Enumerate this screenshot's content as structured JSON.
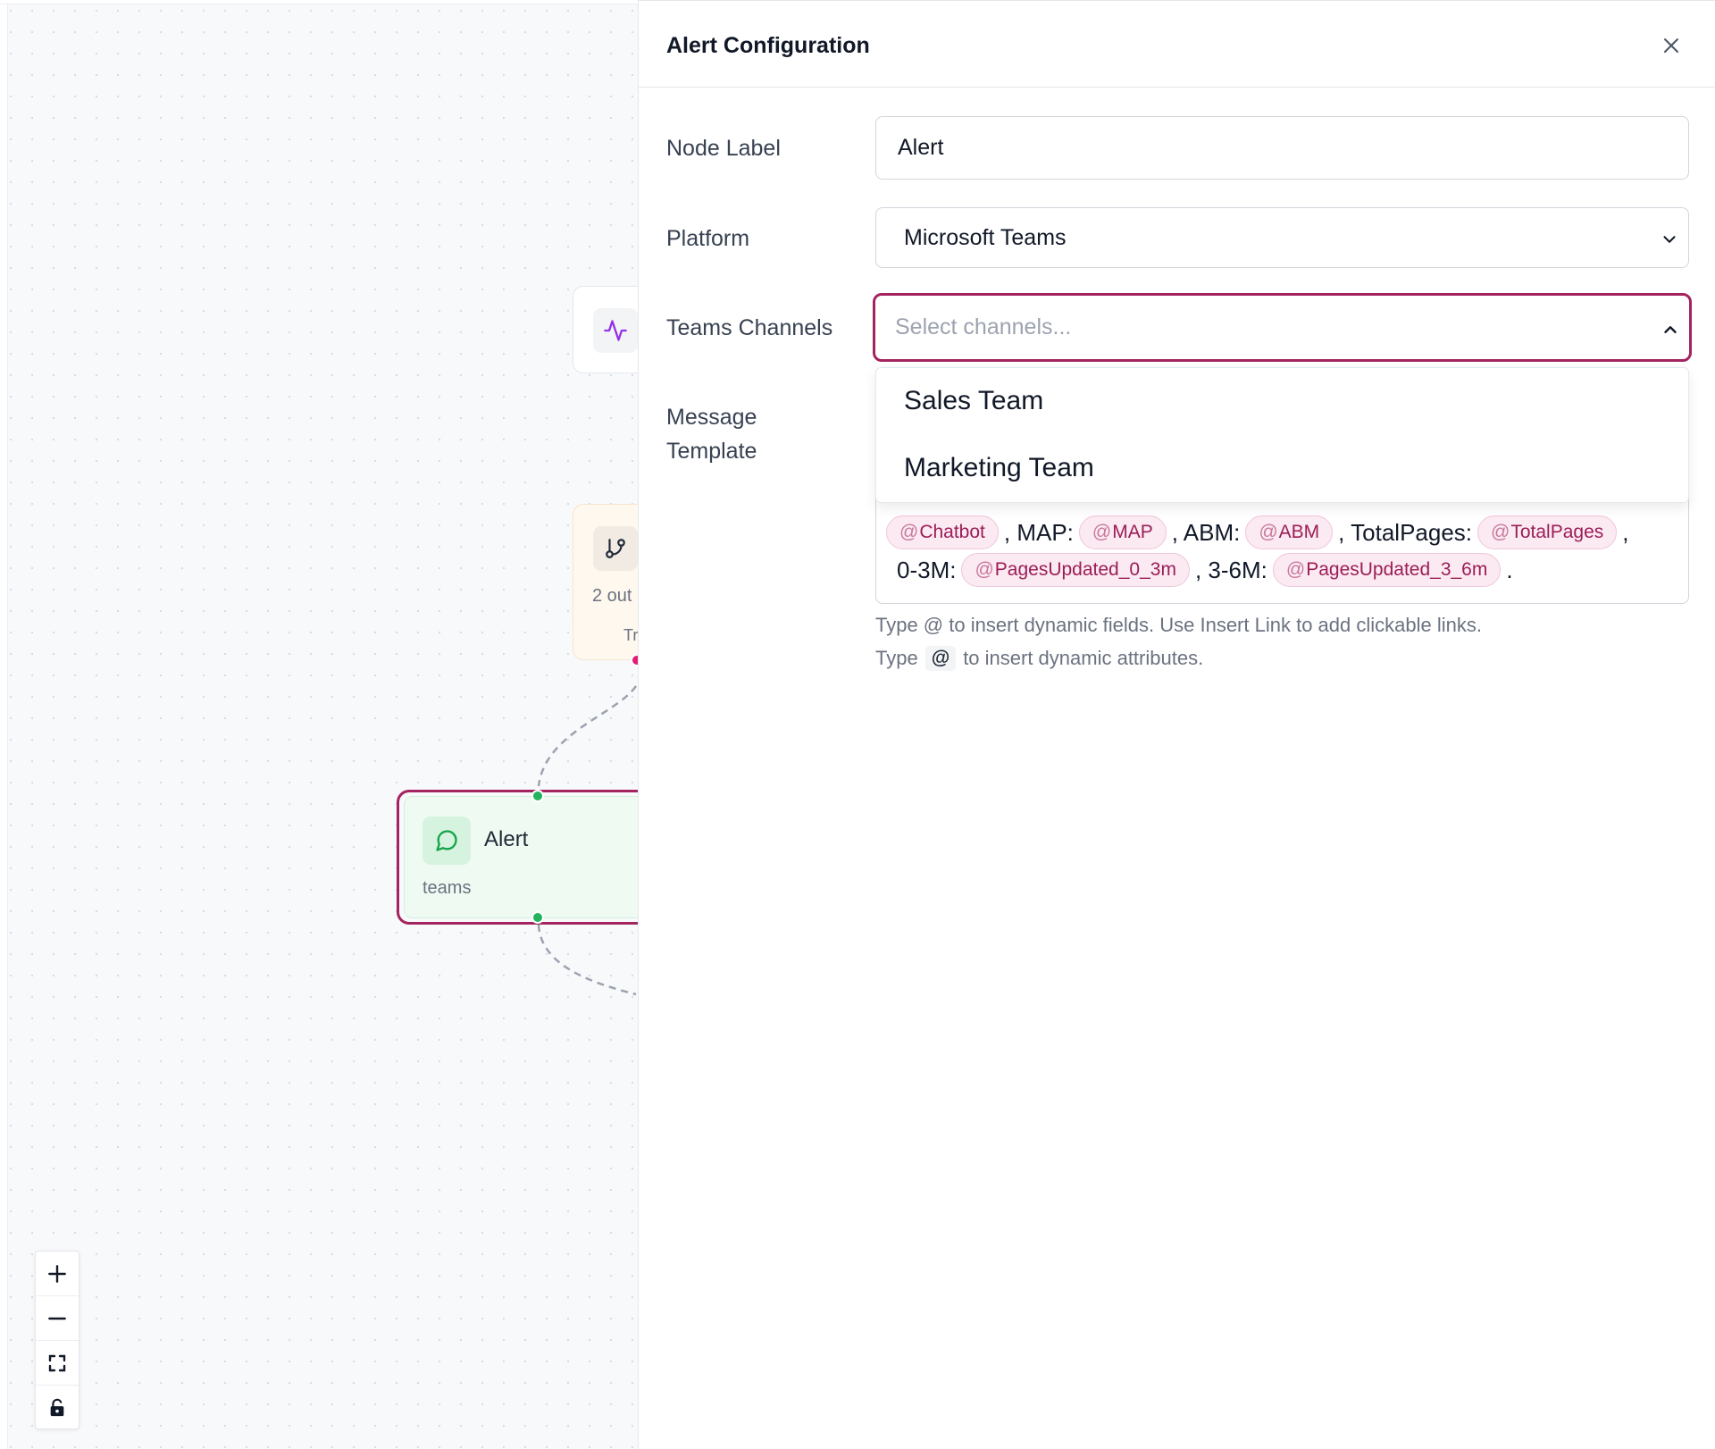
{
  "canvas": {
    "activity_node": {
      "icon": "activity-icon"
    },
    "branch_node": {
      "icon": "git-branch-icon",
      "subtitle": "2 out",
      "hint": "Tr"
    },
    "alert_node": {
      "title": "Alert",
      "subtitle": "teams",
      "icon": "message-circle-icon",
      "accent": "#a3245f",
      "handle_color": "#22b35d"
    },
    "zoom_controls": [
      "zoom-in",
      "zoom-out",
      "fit-view",
      "lock"
    ]
  },
  "panel": {
    "title": "Alert Configuration",
    "fields": {
      "node_label": {
        "label": "Node Label",
        "value": "Alert"
      },
      "platform": {
        "label": "Platform",
        "value": "Microsoft Teams"
      },
      "teams_channels": {
        "label": "Teams Channels",
        "placeholder": "Select channels...",
        "options": [
          "Sales Team",
          "Marketing Team"
        ]
      },
      "message_template": {
        "label_line1": "Message",
        "label_line2": "Template",
        "line1": {
          "chip_chatbot": "Chatbot",
          "t_map": ", MAP:",
          "chip_map": "MAP",
          "t_abm": ", ABM:",
          "chip_abm": "ABM",
          "t_total": ", TotalPages:",
          "chip_total": "TotalPages",
          "t_end": ","
        },
        "line2": {
          "t_03": "0-3M:",
          "chip_03": "PagesUpdated_0_3m",
          "t_36": ", 3-6M:",
          "chip_36": "PagesUpdated_3_6m",
          "t_end": "."
        }
      }
    },
    "help": {
      "line1": "Type @ to insert dynamic fields. Use Insert Link to add clickable links.",
      "line2_pre": "Type",
      "line2_key": "@",
      "line2_post": "to insert dynamic attributes."
    },
    "accent_color": "#a3245f"
  }
}
